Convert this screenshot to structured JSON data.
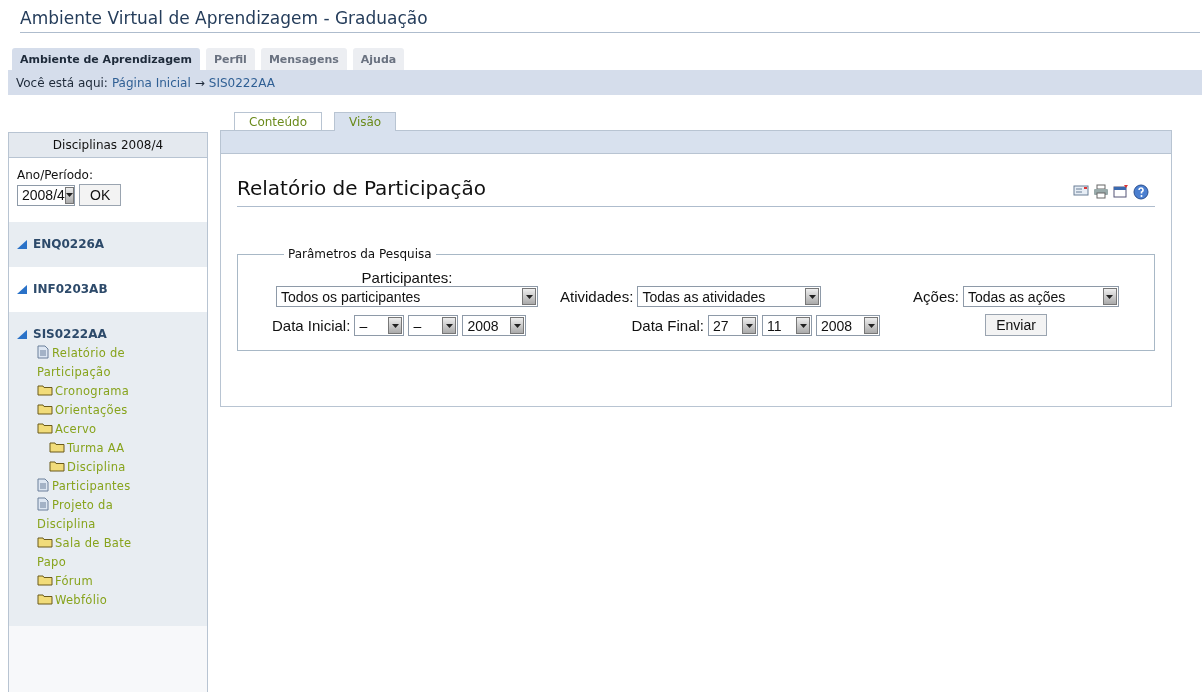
{
  "header": {
    "title": "Ambiente Virtual de Aprendizagem - Graduação"
  },
  "nav_tabs": [
    {
      "label": "Ambiente de Aprendizagem",
      "selected": true
    },
    {
      "label": "Perfil",
      "selected": false
    },
    {
      "label": "Mensagens",
      "selected": false
    },
    {
      "label": "Ajuda",
      "selected": false
    }
  ],
  "breadcrumb": {
    "prefix": "Você está aqui:",
    "links": [
      "Página Inicial",
      "SIS0222AA"
    ],
    "separator": "→"
  },
  "sidebar": {
    "title": "Disciplinas 2008/4",
    "period_label": "Ano/Período:",
    "period_value": "2008/4",
    "ok_button": "OK",
    "courses": [
      {
        "code": "ENQ0226A"
      },
      {
        "code": "INF0203AB"
      },
      {
        "code": "SIS0222AA",
        "children": [
          {
            "kind": "page",
            "label": "Relatório de Participação"
          },
          {
            "kind": "folder",
            "label": "Cronograma"
          },
          {
            "kind": "folder",
            "label": "Orientações"
          },
          {
            "kind": "folder",
            "label": "Acervo",
            "children": [
              {
                "kind": "folder",
                "label": "Turma AA"
              },
              {
                "kind": "folder",
                "label": "Disciplina"
              }
            ]
          },
          {
            "kind": "page",
            "label": "Participantes"
          },
          {
            "kind": "page",
            "label": "Projeto da Disciplina"
          },
          {
            "kind": "folder",
            "label": "Sala de Bate Papo"
          },
          {
            "kind": "folder",
            "label": "Fórum"
          },
          {
            "kind": "folder",
            "label": "Webfólio"
          }
        ]
      }
    ]
  },
  "content_tabs": [
    {
      "label": "Conteúdo",
      "selected": false
    },
    {
      "label": "Visão",
      "selected": true
    }
  ],
  "report": {
    "title": "Relatório de Participação",
    "legend": "Parâmetros da Pesquisa",
    "participants": {
      "label": "Participantes:",
      "value": "Todos os participantes"
    },
    "activities": {
      "label": "Atividades:",
      "value": "Todas as atividades"
    },
    "actions": {
      "label": "Ações:",
      "value": "Todas as ações"
    },
    "start_date": {
      "label": "Data Inicial:",
      "day": "–",
      "month": "–",
      "year": "2008"
    },
    "end_date": {
      "label": "Data Final:",
      "day": "27",
      "month": "11",
      "year": "2008"
    },
    "submit": "Enviar"
  }
}
